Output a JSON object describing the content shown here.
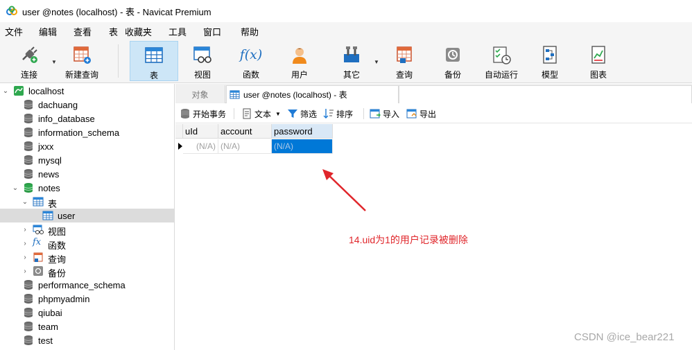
{
  "window": {
    "title": "user @notes (localhost) - 表 - Navicat Premium"
  },
  "menu": [
    "文件",
    "编辑",
    "查看",
    "表",
    "收藏夹",
    "工具",
    "窗口",
    "帮助"
  ],
  "toolbar": {
    "connect": "连接",
    "new_query": "新建查询",
    "table": "表",
    "view": "视图",
    "function": "函数",
    "user": "用户",
    "other": "其它",
    "query": "查询",
    "backup": "备份",
    "autorun": "自动运行",
    "model": "模型",
    "chart": "图表",
    "fx_glyph": "f(x)"
  },
  "tree": {
    "root": "localhost",
    "databases_top": [
      "dachuang",
      "info_database",
      "information_schema",
      "jxxx",
      "mysql",
      "news"
    ],
    "notes": "notes",
    "notes_children": {
      "tables": "表",
      "user": "user",
      "views": "视图",
      "functions": "函数",
      "queries": "查询",
      "backups": "备份"
    },
    "databases_bottom": [
      "performance_schema",
      "phpmyadmin",
      "qiubai",
      "team",
      "test"
    ]
  },
  "tabs": {
    "objects": "对象",
    "current": "user @notes (localhost) - 表"
  },
  "subtoolbar": {
    "begin_tx": "开始事务",
    "text": "文本",
    "filter": "筛选",
    "sort": "排序",
    "import": "导入",
    "export": "导出"
  },
  "grid": {
    "columns": [
      "uId",
      "account",
      "password"
    ],
    "rows": [
      [
        "(N/A)",
        "(N/A)",
        "(N/A)"
      ]
    ]
  },
  "annotation": "14.uid为1的用户记录被删除",
  "watermark": "CSDN @ice_bear221",
  "colors": {
    "accent": "#0078d7",
    "annotation": "#e0262b",
    "db_active": "#2fa84f"
  }
}
